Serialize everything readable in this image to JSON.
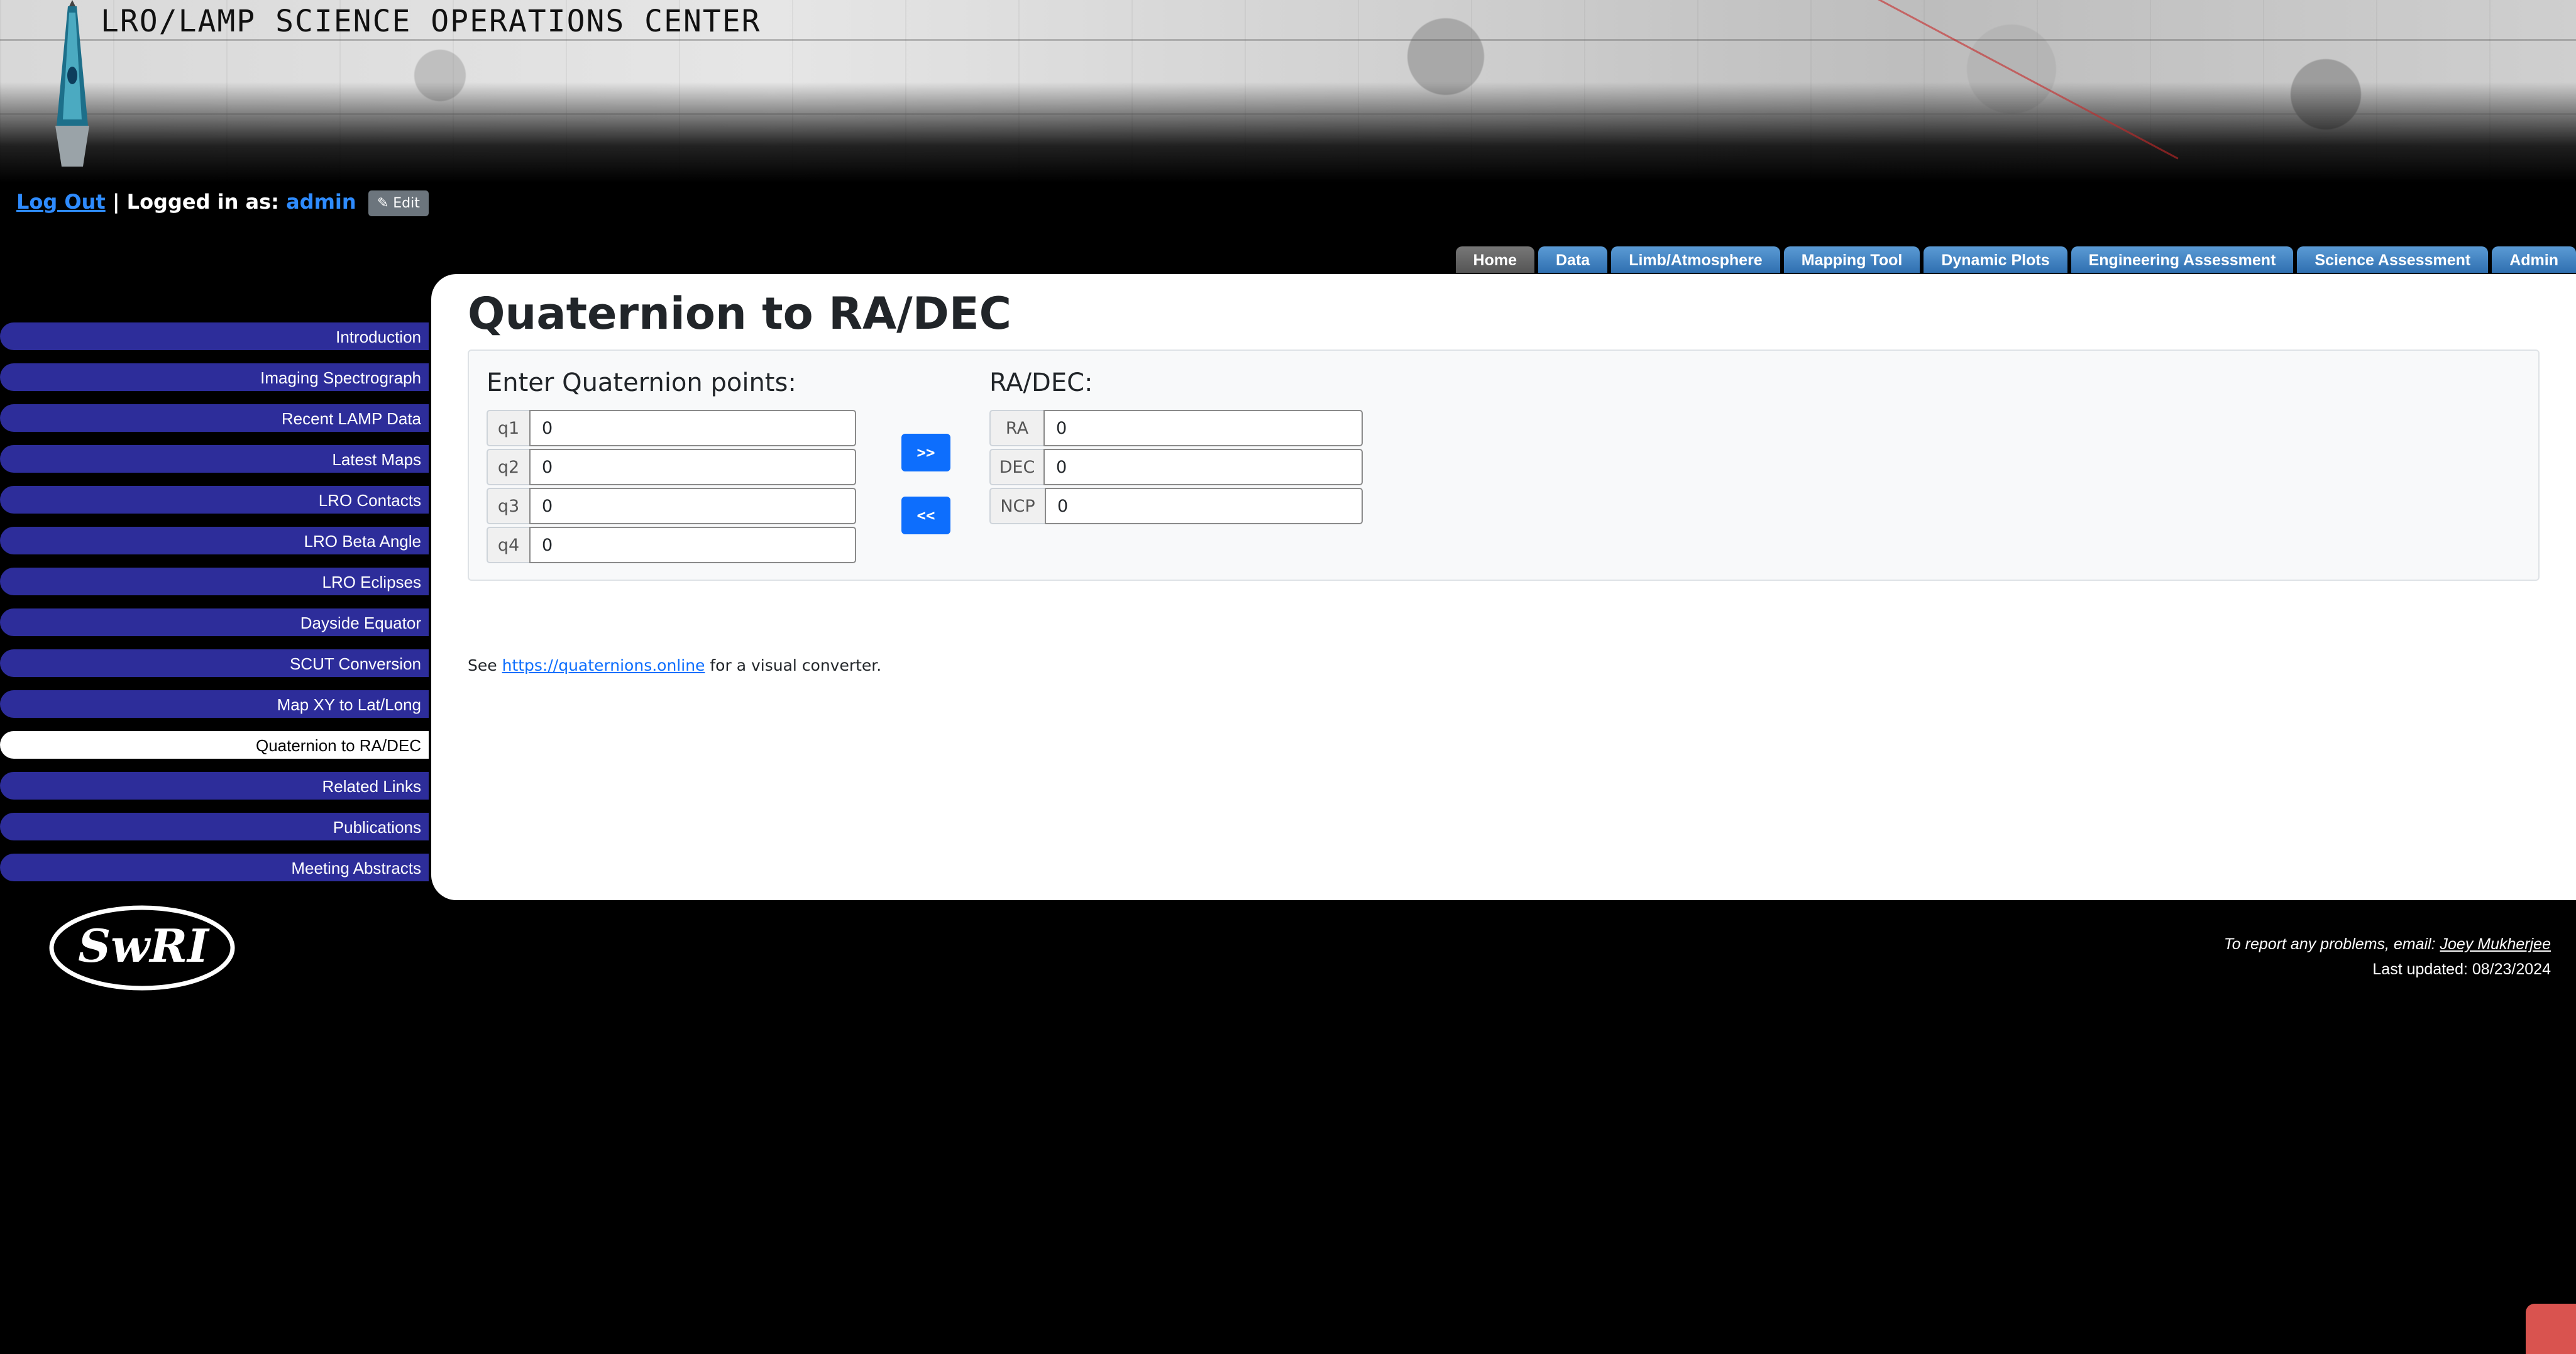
{
  "header": {
    "title": "LRO/LAMP SCIENCE OPERATIONS CENTER"
  },
  "session": {
    "logout_label": "Log Out",
    "separator": "|",
    "logged_in_prefix": "Logged in as:",
    "username": "admin",
    "edit_label": "Edit"
  },
  "tabs": [
    {
      "label": "Home"
    },
    {
      "label": "Data"
    },
    {
      "label": "Limb/Atmosphere"
    },
    {
      "label": "Mapping Tool"
    },
    {
      "label": "Dynamic Plots"
    },
    {
      "label": "Engineering Assessment"
    },
    {
      "label": "Science Assessment"
    },
    {
      "label": "Admin"
    }
  ],
  "sidebar": {
    "items": [
      {
        "label": "Introduction"
      },
      {
        "label": "Imaging Spectrograph"
      },
      {
        "label": "Recent LAMP Data"
      },
      {
        "label": "Latest Maps"
      },
      {
        "label": "LRO Contacts"
      },
      {
        "label": "LRO Beta Angle"
      },
      {
        "label": "LRO Eclipses"
      },
      {
        "label": "Dayside Equator"
      },
      {
        "label": "SCUT Conversion"
      },
      {
        "label": "Map XY to Lat/Long"
      },
      {
        "label": "Quaternion to RA/DEC"
      },
      {
        "label": "Related Links"
      },
      {
        "label": "Publications"
      },
      {
        "label": "Meeting Abstracts"
      }
    ],
    "active_index": 10
  },
  "main": {
    "title": "Quaternion to RA/DEC",
    "quaternion": {
      "heading": "Enter Quaternion points:",
      "fields": [
        {
          "label": "q1",
          "value": "0"
        },
        {
          "label": "q2",
          "value": "0"
        },
        {
          "label": "q3",
          "value": "0"
        },
        {
          "label": "q4",
          "value": "0"
        }
      ]
    },
    "radec": {
      "heading": "RA/DEC:",
      "fields": [
        {
          "label": "RA",
          "value": "0"
        },
        {
          "label": "DEC",
          "value": "0"
        },
        {
          "label": "NCP",
          "value": "0"
        }
      ]
    },
    "buttons": {
      "forward": ">>",
      "back": "<<"
    },
    "note": {
      "prefix": "See",
      "link_text": "https://quaternions.online",
      "suffix": "for a visual converter."
    }
  },
  "footer": {
    "logo_text": "SwRI",
    "report_text": "To report any problems, email:",
    "contact_name": "Joey Mukherjee",
    "last_updated": "Last updated: 08/23/2024"
  },
  "colors": {
    "nav_bg": "#2d2d9a",
    "tab_bg": "#3d7fc2",
    "primary_button": "#0d6efd",
    "link": "#2e8bff"
  }
}
